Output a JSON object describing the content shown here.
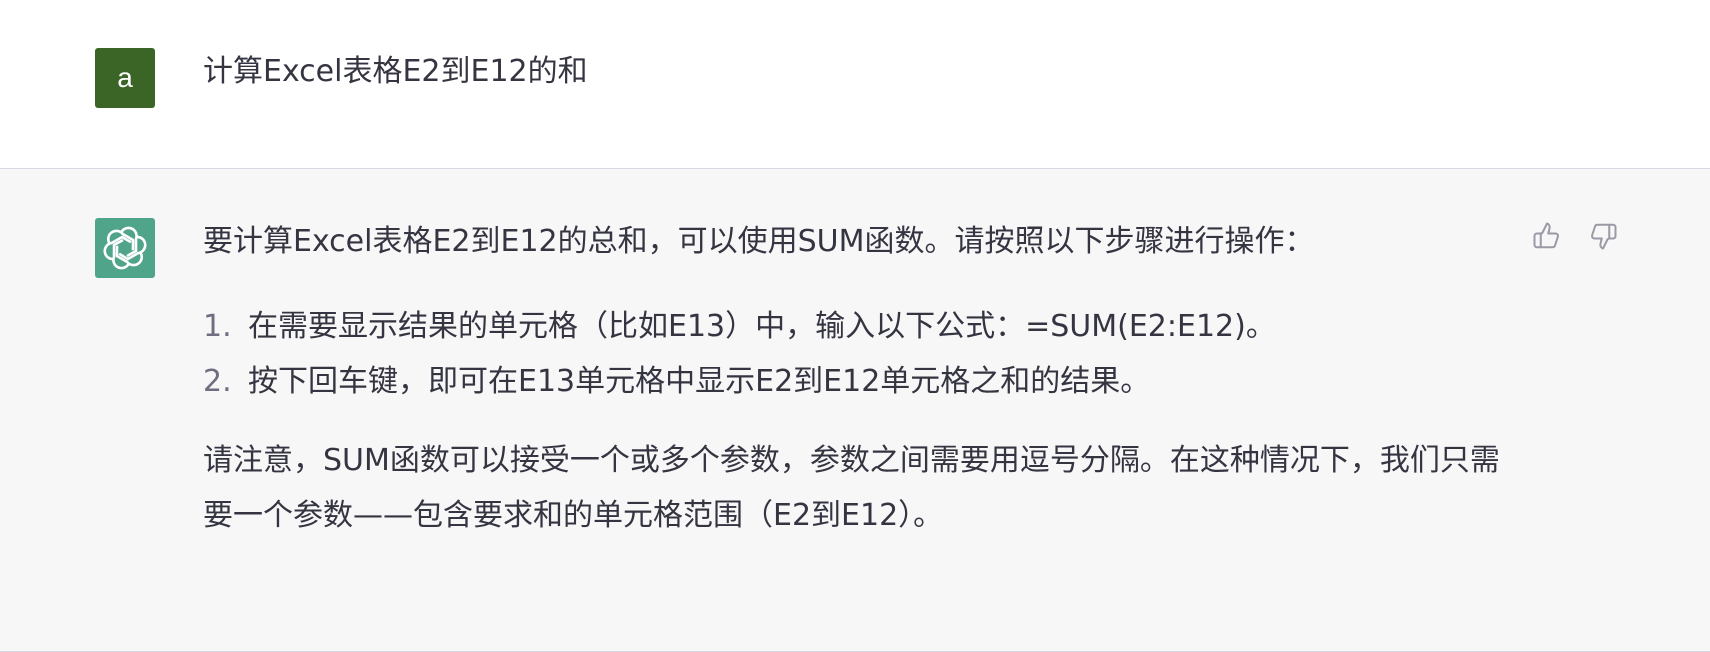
{
  "user": {
    "avatar_letter": "a",
    "avatar_color": "#3b6526",
    "message": "计算Excel表格E2到E12的和"
  },
  "assistant": {
    "avatar_icon": "openai-logo-icon",
    "avatar_color": "#4fa48a",
    "intro": "要计算Excel表格E2到E12的总和，可以使用SUM函数。请按照以下步骤进行操作：",
    "steps": [
      {
        "num": "1.",
        "text": "在需要显示结果的单元格（比如E13）中，输入以下公式：=SUM(E2:E12)。"
      },
      {
        "num": "2.",
        "text": "按下回车键，即可在E13单元格中显示E2到E12单元格之和的结果。"
      }
    ],
    "note": "请注意，SUM函数可以接受一个或多个参数，参数之间需要用逗号分隔。在这种情况下，我们只需要一个参数——包含要求和的单元格范围（E2到E12）。"
  },
  "feedback": {
    "thumbs_up_icon": "thumbs-up-icon",
    "thumbs_down_icon": "thumbs-down-icon"
  }
}
